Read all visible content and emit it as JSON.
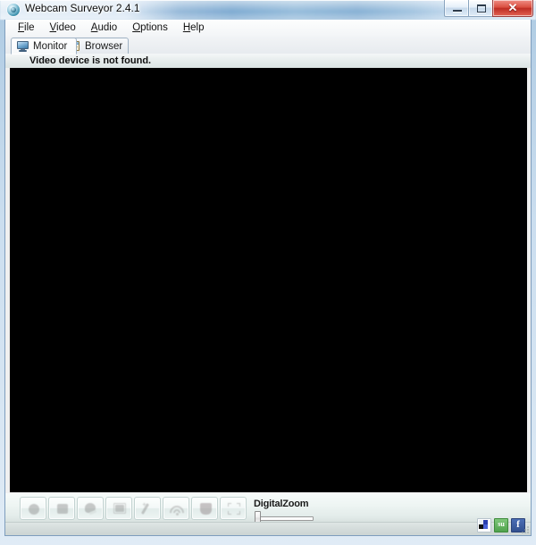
{
  "window": {
    "title": "Webcam Surveyor 2.4.1",
    "app_icon": "webcam-icon",
    "controls": {
      "minimize_label": "",
      "maximize_label": "",
      "close_label": "✕"
    }
  },
  "menu": {
    "items": [
      {
        "label": "File",
        "accel": "F",
        "rest": "ile"
      },
      {
        "label": "Video",
        "accel": "V",
        "rest": "ideo"
      },
      {
        "label": "Audio",
        "accel": "A",
        "rest": "udio"
      },
      {
        "label": "Options",
        "accel": "O",
        "rest": "ptions"
      },
      {
        "label": "Help",
        "accel": "H",
        "rest": "elp"
      }
    ]
  },
  "tabs": [
    {
      "label": "Monitor",
      "icon": "monitor-icon",
      "active": true
    },
    {
      "label": "Browser",
      "icon": "browser-icon",
      "active": false
    }
  ],
  "status": {
    "message": "Video device is not found."
  },
  "video": {
    "background_color": "#000000",
    "content": ""
  },
  "toolbar": {
    "buttons": [
      {
        "name": "record-button",
        "icon": "record-icon",
        "enabled": false
      },
      {
        "name": "stop-button",
        "icon": "stop-square-icon",
        "enabled": false
      },
      {
        "name": "snapshot-button",
        "icon": "snapshot-icon",
        "enabled": false
      },
      {
        "name": "frame-button",
        "icon": "frame-icon",
        "enabled": false
      },
      {
        "name": "wand-button",
        "icon": "magic-wand-icon",
        "enabled": false
      },
      {
        "name": "broadcast-button",
        "icon": "wifi-signal-icon",
        "enabled": false
      },
      {
        "name": "security-button",
        "icon": "shield-icon",
        "enabled": false
      },
      {
        "name": "fullscreen-button",
        "icon": "fullscreen-icon",
        "enabled": false
      }
    ]
  },
  "zoom_control": {
    "label": "DigitalZoom",
    "value": 0,
    "min": 0,
    "max": 100
  },
  "share": {
    "icons": [
      {
        "name": "windows-share-icon",
        "label": ""
      },
      {
        "name": "stumbleupon-share-icon",
        "label": "su"
      },
      {
        "name": "facebook-share-icon",
        "label": "f"
      }
    ]
  },
  "colors": {
    "frame": "#aac8e1",
    "close_button": "#c2281f",
    "video": "#000000",
    "control_bar": "#e3ecea",
    "facebook": "#32508f",
    "stumbleupon": "#4fa24c"
  }
}
